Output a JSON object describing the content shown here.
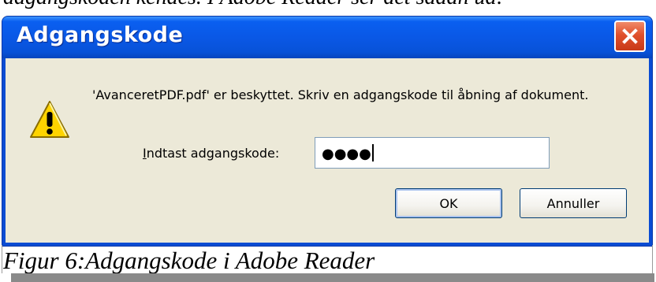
{
  "document": {
    "clipped_text_above": "adgangskoden kendes. I Adobe Reader ser det sådan ud:",
    "caption": "Figur 6:Adgangskode i Adobe Reader"
  },
  "dialog": {
    "title": "Adgangskode",
    "close_icon": "close-icon",
    "warning_icon": "warning-icon",
    "message": "'AvanceretPDF.pdf' er beskyttet. Skriv en adgangskode til åbning af dokument.",
    "password_label_hotkey": "I",
    "password_label_rest": "ndtast adgangskode:",
    "password_value": "●●●●",
    "ok_label": "OK",
    "cancel_label": "Annuller"
  },
  "colors": {
    "titlebar": "#0a58e6",
    "client": "#ece9d8",
    "close_button": "#e0502c",
    "warning": "#ffd400"
  }
}
